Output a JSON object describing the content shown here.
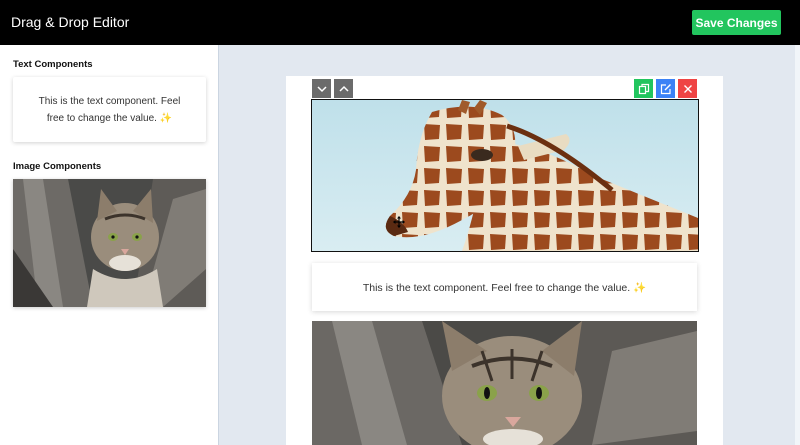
{
  "header": {
    "title": "Drag & Drop Editor",
    "save_label": "Save Changes"
  },
  "sidebar": {
    "text_heading": "Text Components",
    "text_component": "This is the text component. Feel free to change the value. ✨",
    "image_heading": "Image Components"
  },
  "editor": {
    "toolbar": {
      "move_down": "chevron-down-icon",
      "move_up": "chevron-up-icon",
      "duplicate": "copy-icon",
      "edit": "edit-icon",
      "delete": "close-icon"
    },
    "text_block": "This is the text component. Feel free to change the value. ✨"
  },
  "colors": {
    "topbar": "#000000",
    "save_button": "#22c55e",
    "duplicate": "#22c55e",
    "edit": "#3b82f6",
    "delete": "#ef4444",
    "canvas_bg": "#e2e8f0"
  }
}
